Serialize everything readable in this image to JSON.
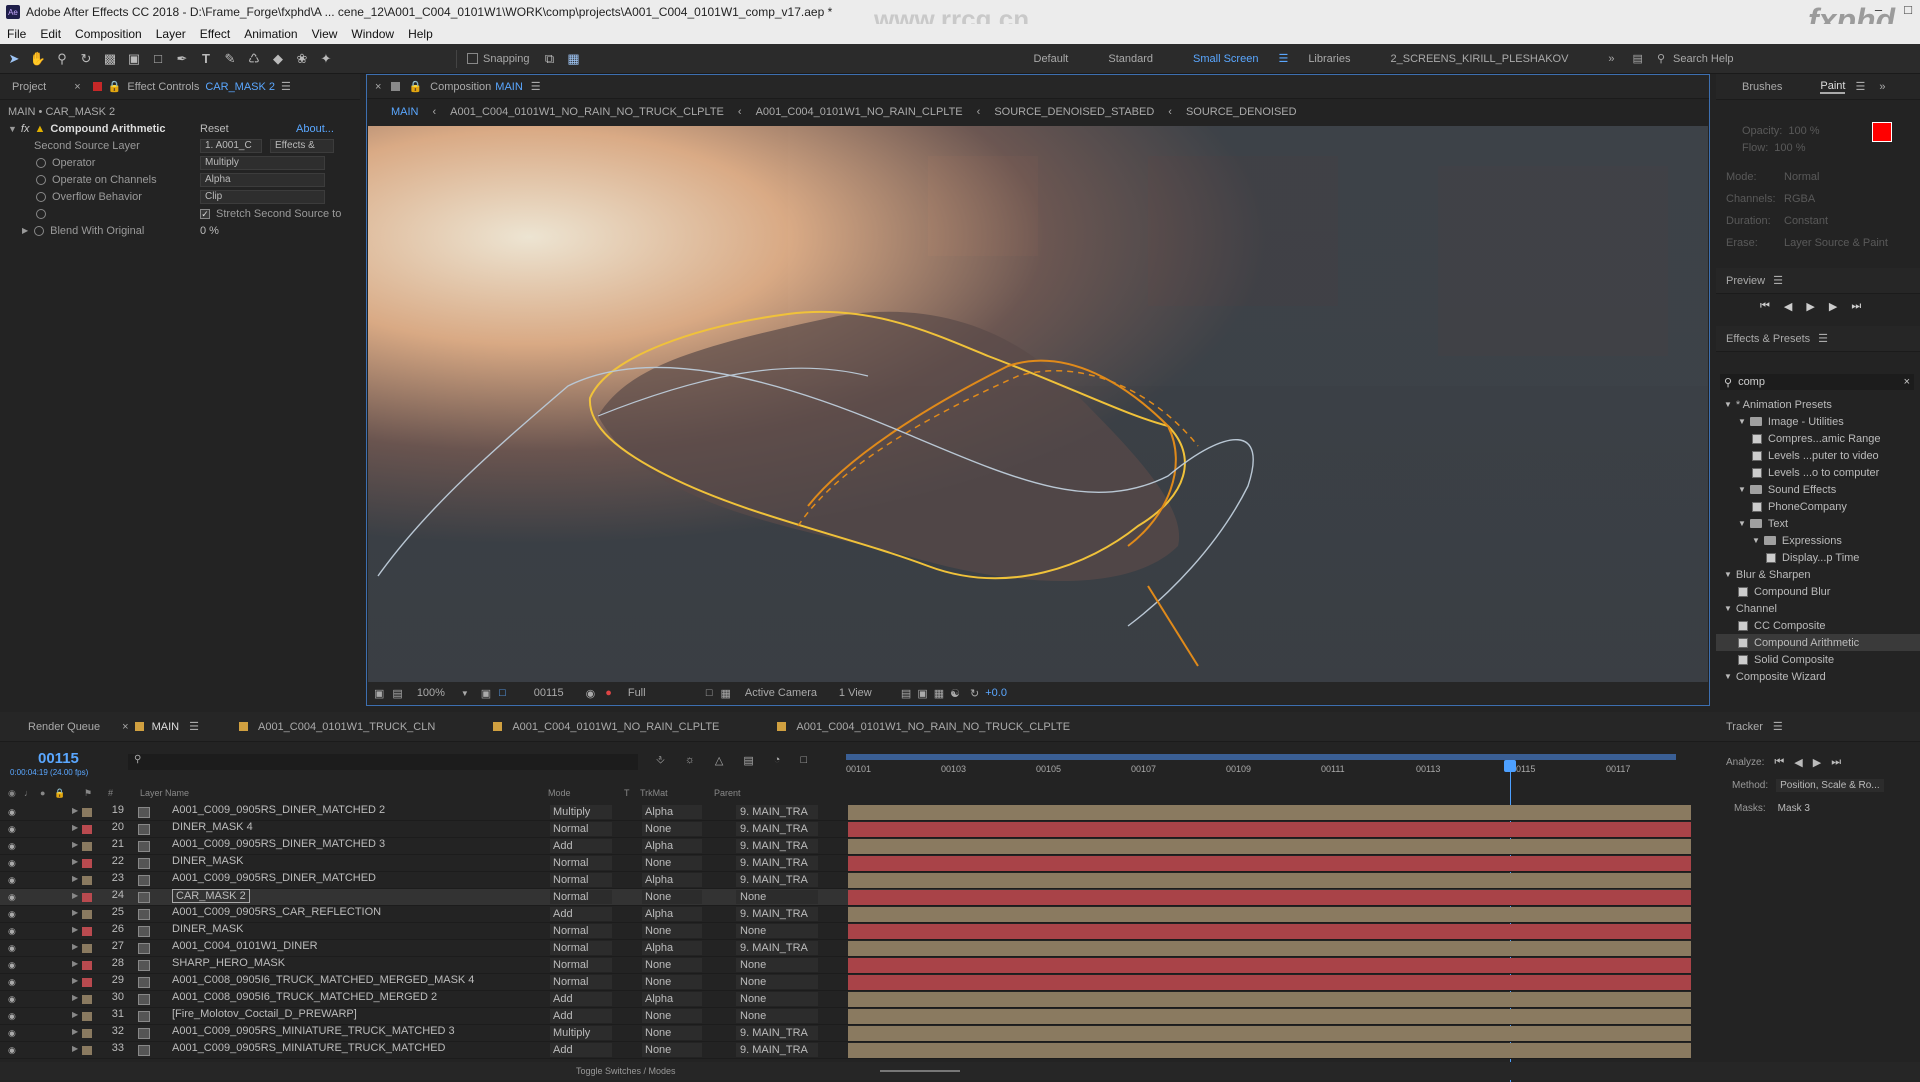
{
  "app": {
    "title": "Adobe After Effects CC 2018 - D:\\Frame_Forge\\fxphd\\A ... cene_12\\A001_C004_0101W1\\WORK\\comp\\projects\\A001_C004_0101W1_comp_v17.aep *",
    "watermark_url": "www.rrcg.cn",
    "watermark_brand": "fxphd"
  },
  "menu": [
    "File",
    "Edit",
    "Composition",
    "Layer",
    "Effect",
    "Animation",
    "View",
    "Window",
    "Help"
  ],
  "toolbar": {
    "snapping": "Snapping",
    "workspaces": [
      "Default",
      "Standard",
      "Small Screen",
      "Libraries",
      "2_SCREENS_KIRILL_PLESHAKOV"
    ],
    "search_help": "Search Help"
  },
  "effect_controls": {
    "tab_project": "Project",
    "tab_label": "Effect Controls",
    "tab_layer": "CAR_MASK 2",
    "context": "MAIN • CAR_MASK 2",
    "effect_name": "Compound Arithmetic",
    "reset": "Reset",
    "about": "About...",
    "props": [
      {
        "label": "Second Source Layer",
        "value": "1. A001_C",
        "value2": "Effects &"
      },
      {
        "label": "Operator",
        "value": "Multiply"
      },
      {
        "label": "Operate on Channels",
        "value": "Alpha"
      },
      {
        "label": "Overflow Behavior",
        "value": "Clip"
      },
      {
        "label": "",
        "value": "Stretch Second Source to"
      },
      {
        "label": "Blend With Original",
        "value": "0 %"
      }
    ]
  },
  "composition": {
    "tab_label": "Composition",
    "tab_name": "MAIN",
    "breadcrumbs": [
      "MAIN",
      "A001_C004_0101W1_NO_RAIN_NO_TRUCK_CLPLTE",
      "A001_C004_0101W1_NO_RAIN_CLPLTE",
      "SOURCE_DENOISED_STABED",
      "SOURCE_DENOISED"
    ],
    "footer": {
      "zoom": "100%",
      "frame": "00115",
      "resolution": "Full",
      "camera": "Active Camera",
      "views": "1 View",
      "exposure": "+0.0"
    }
  },
  "right_panel": {
    "tabs": [
      "Brushes",
      "Paint"
    ],
    "paint_props": [
      {
        "label": "Opacity:",
        "value": "100 %"
      },
      {
        "label": "Flow:",
        "value": "100 %"
      },
      {
        "label": "Mode:",
        "value": "Normal"
      },
      {
        "label": "Channels:",
        "value": "RGBA"
      },
      {
        "label": "Duration:",
        "value": "Constant"
      },
      {
        "label": "Erase:",
        "value": "Layer Source & Paint"
      }
    ],
    "preview_label": "Preview",
    "effects_presets_label": "Effects & Presets",
    "search_value": "comp",
    "tree": [
      {
        "label": "* Animation Presets",
        "level": 0,
        "type": "root"
      },
      {
        "label": "Image - Utilities",
        "level": 1,
        "type": "folder"
      },
      {
        "label": "Compres...amic Range",
        "level": 2,
        "type": "fx"
      },
      {
        "label": "Levels ...puter to video",
        "level": 2,
        "type": "fx"
      },
      {
        "label": "Levels ...o to computer",
        "level": 2,
        "type": "fx"
      },
      {
        "label": "Sound Effects",
        "level": 1,
        "type": "folder"
      },
      {
        "label": "PhoneCompany",
        "level": 2,
        "type": "fx"
      },
      {
        "label": "Text",
        "level": 1,
        "type": "folder"
      },
      {
        "label": "Expressions",
        "level": 2,
        "type": "folder"
      },
      {
        "label": "Display...p Time",
        "level": 3,
        "type": "fx"
      },
      {
        "label": "Blur & Sharpen",
        "level": 0,
        "type": "root"
      },
      {
        "label": "Compound Blur",
        "level": 1,
        "type": "fx"
      },
      {
        "label": "Channel",
        "level": 0,
        "type": "root"
      },
      {
        "label": "CC Composite",
        "level": 1,
        "type": "fx"
      },
      {
        "label": "Compound Arithmetic",
        "level": 1,
        "type": "fx",
        "selected": true
      },
      {
        "label": "Solid Composite",
        "level": 1,
        "type": "fx"
      },
      {
        "label": "Composite Wizard",
        "level": 0,
        "type": "root"
      }
    ]
  },
  "timeline": {
    "tabs": [
      "Render Queue",
      "MAIN",
      "A001_C004_0101W1_TRUCK_CLN",
      "A001_C004_0101W1_NO_RAIN_CLPLTE",
      "A001_C004_0101W1_NO_RAIN_NO_TRUCK_CLPLTE"
    ],
    "timecode": "00115",
    "timecode_sub": "0:00:04:19 (24.00 fps)",
    "columns": {
      "layer_name": "Layer Name",
      "mode": "Mode",
      "t": "T",
      "trkmat": "TrkMat",
      "parent": "Parent"
    },
    "ruler": [
      "00101",
      "00103",
      "00105",
      "00107",
      "00109",
      "00111",
      "00113",
      "00115",
      "00117"
    ],
    "footer": "Toggle Switches / Modes",
    "layers": [
      {
        "num": "19",
        "name": "A001_C009_0905RS_DINER_MATCHED 2",
        "mode": "Multiply",
        "trk": "Alpha",
        "parent": "9. MAIN_TRA",
        "color": "tan",
        "label": "#8a7a60"
      },
      {
        "num": "20",
        "name": "DINER_MASK 4",
        "mode": "Normal",
        "trk": "None",
        "parent": "9. MAIN_TRA",
        "color": "red",
        "label": "#b94a4f"
      },
      {
        "num": "21",
        "name": "A001_C009_0905RS_DINER_MATCHED 3",
        "mode": "Add",
        "trk": "Alpha",
        "parent": "9. MAIN_TRA",
        "color": "tan",
        "label": "#8a7a60"
      },
      {
        "num": "22",
        "name": "DINER_MASK",
        "mode": "Normal",
        "trk": "None",
        "parent": "9. MAIN_TRA",
        "color": "red",
        "label": "#b94a4f"
      },
      {
        "num": "23",
        "name": "A001_C009_0905RS_DINER_MATCHED",
        "mode": "Normal",
        "trk": "Alpha",
        "parent": "9. MAIN_TRA",
        "color": "tan",
        "label": "#8a7a60"
      },
      {
        "num": "24",
        "name": "CAR_MASK 2",
        "mode": "Normal",
        "trk": "None",
        "parent": "None",
        "color": "red",
        "label": "#b94a4f",
        "selected": true
      },
      {
        "num": "25",
        "name": "A001_C009_0905RS_CAR_REFLECTION",
        "mode": "Add",
        "trk": "Alpha",
        "parent": "9. MAIN_TRA",
        "color": "tan",
        "label": "#8a7a60"
      },
      {
        "num": "26",
        "name": "DINER_MASK",
        "mode": "Normal",
        "trk": "None",
        "parent": "None",
        "color": "red",
        "label": "#b94a4f"
      },
      {
        "num": "27",
        "name": "A001_C004_0101W1_DINER",
        "mode": "Normal",
        "trk": "Alpha",
        "parent": "9. MAIN_TRA",
        "color": "tan",
        "label": "#8a7a60"
      },
      {
        "num": "28",
        "name": "SHARP_HERO_MASK",
        "mode": "Normal",
        "trk": "None",
        "parent": "None",
        "color": "red",
        "label": "#b94a4f"
      },
      {
        "num": "29",
        "name": "A001_C008_0905I6_TRUCK_MATCHED_MERGED_MASK 4",
        "mode": "Normal",
        "trk": "None",
        "parent": "None",
        "color": "red",
        "label": "#b94a4f"
      },
      {
        "num": "30",
        "name": "A001_C008_0905I6_TRUCK_MATCHED_MERGED 2",
        "mode": "Add",
        "trk": "Alpha",
        "parent": "None",
        "color": "tan",
        "label": "#8a7a60"
      },
      {
        "num": "31",
        "name": "[Fire_Molotov_Coctail_D_PREWARP]",
        "mode": "Add",
        "trk": "None",
        "parent": "None",
        "color": "tan",
        "label": "#8a7a60"
      },
      {
        "num": "32",
        "name": "A001_C009_0905RS_MINIATURE_TRUCK_MATCHED 3",
        "mode": "Multiply",
        "trk": "None",
        "parent": "9. MAIN_TRA",
        "color": "tan",
        "label": "#8a7a60"
      },
      {
        "num": "33",
        "name": "A001_C009_0905RS_MINIATURE_TRUCK_MATCHED",
        "mode": "Add",
        "trk": "None",
        "parent": "9. MAIN_TRA",
        "color": "tan",
        "label": "#8a7a60"
      }
    ]
  },
  "tracker": {
    "label": "Tracker",
    "analyze": "Analyze:",
    "method_label": "Method:",
    "method_value": "Position, Scale & Ro...",
    "masks_label": "Masks:",
    "masks_value": "Mask 3"
  },
  "colors": {
    "accent": "#5aa7ff",
    "paint_fg": "#ff0000",
    "layer_red": "#a94348",
    "layer_tan": "#8a7a60"
  }
}
